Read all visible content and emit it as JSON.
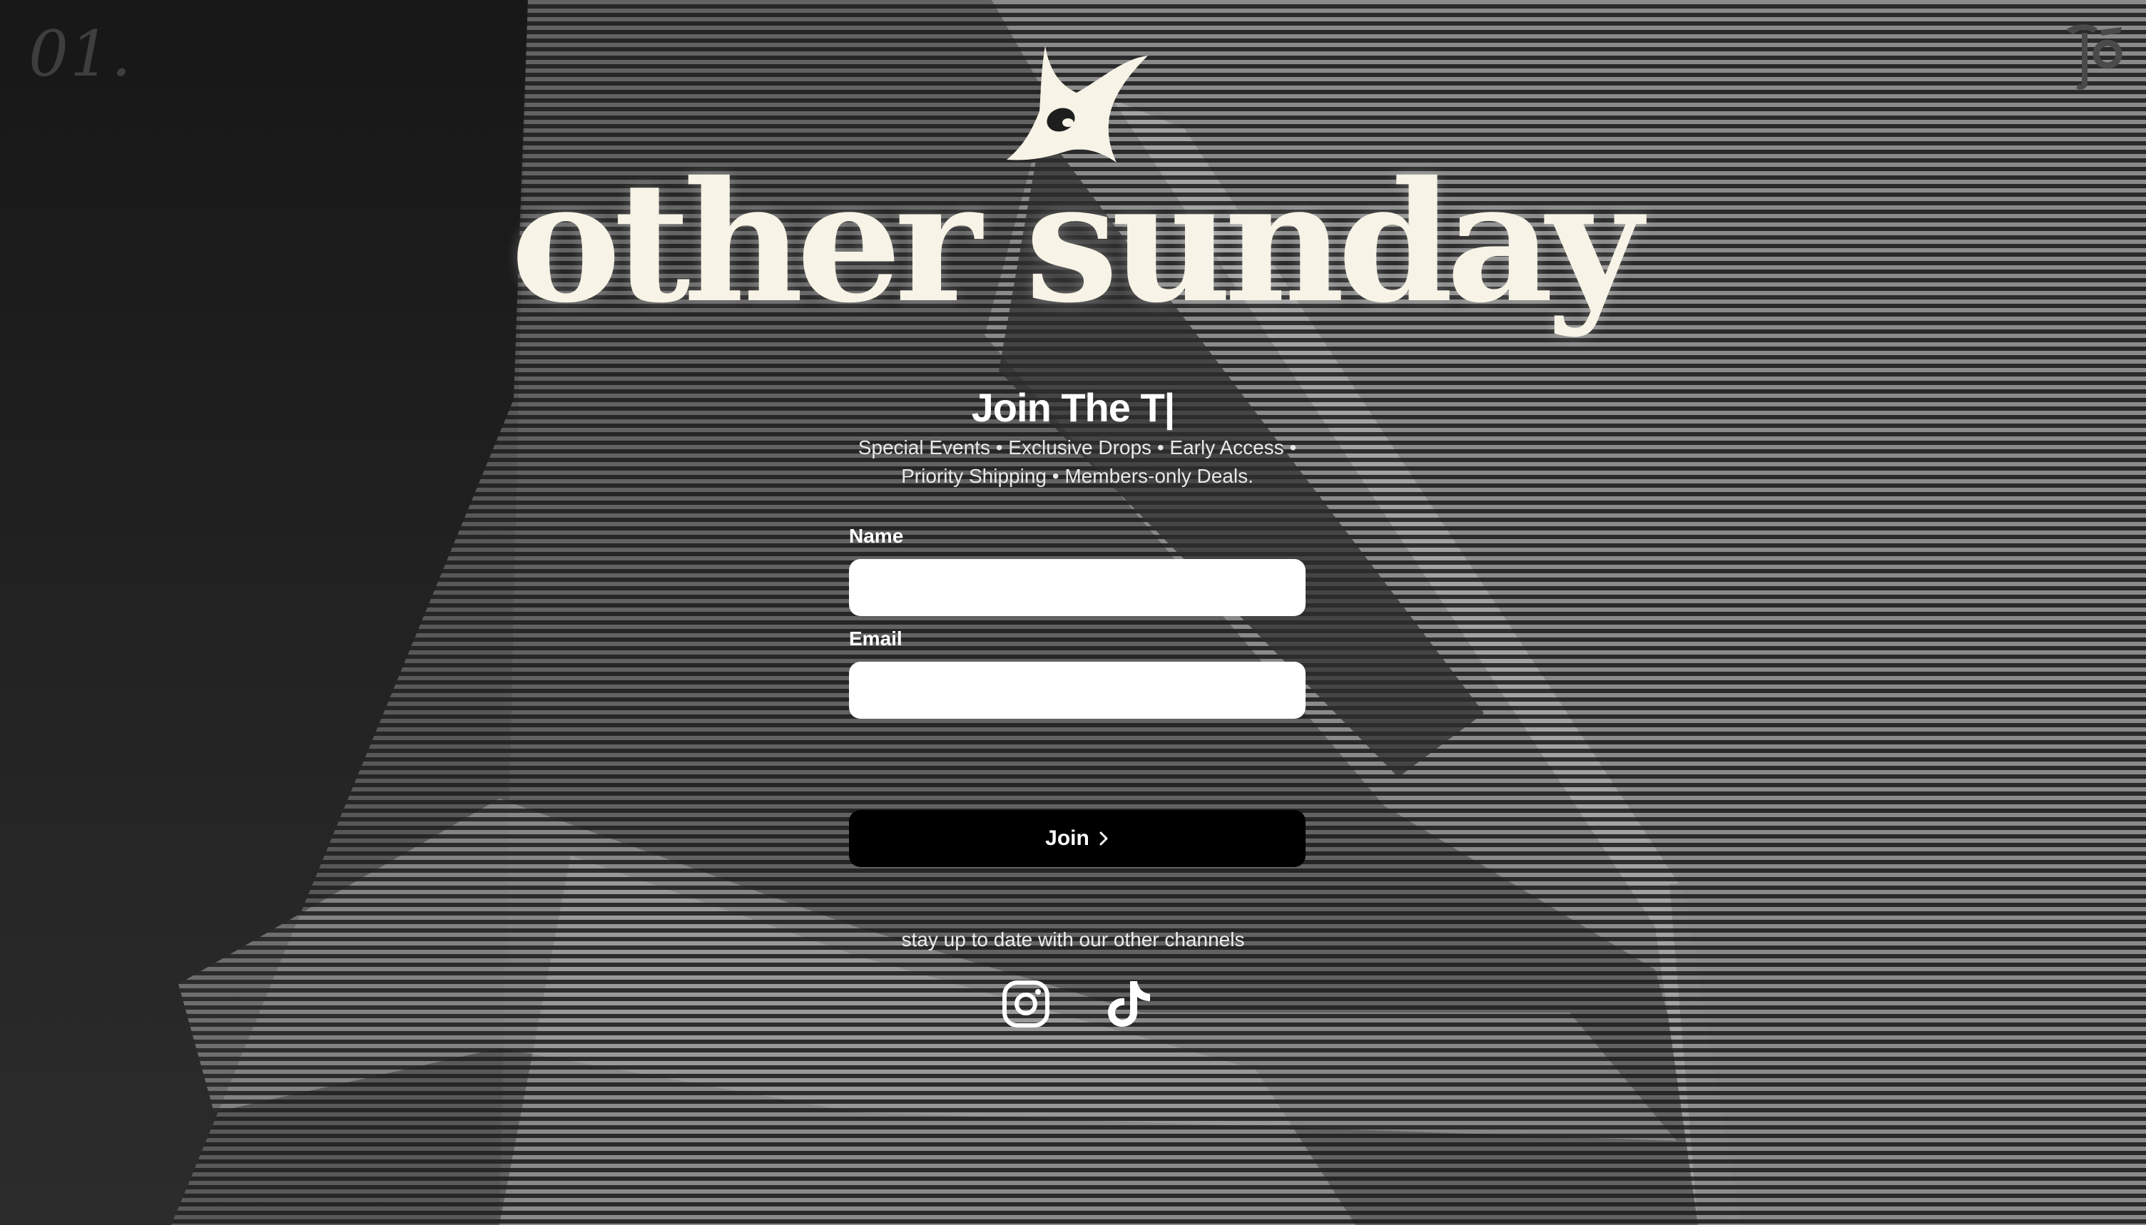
{
  "page": {
    "corner_number": "01.",
    "brand_name": "other sunday"
  },
  "signup": {
    "title": "Join The T|",
    "subtitle": "Special Events • Exclusive Drops • Early Access • Priority Shipping • Members-only Deals.",
    "name_label": "Name",
    "name_value": "",
    "email_label": "Email",
    "email_value": "",
    "join_label": "Join"
  },
  "footer": {
    "channels_text": "stay up to date with our other channels",
    "social": [
      {
        "icon": "instagram-icon"
      },
      {
        "icon": "tiktok-icon"
      }
    ]
  },
  "colors": {
    "background": "#1a1a1a",
    "brand_text": "#f7f3e6",
    "button": "#000000",
    "input": "#ffffff"
  }
}
